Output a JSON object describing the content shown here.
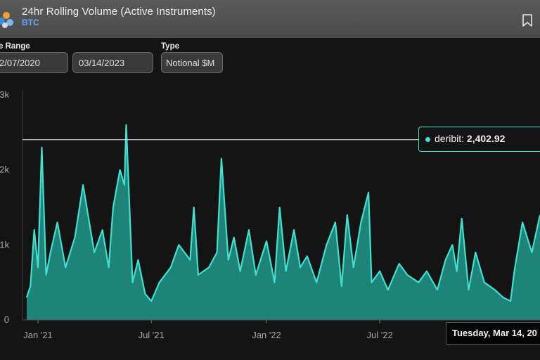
{
  "header": {
    "title": "24hr Rolling Volume (Active Instruments)",
    "subtitle": "BTC",
    "bookmark_icon": "bookmark-icon",
    "logo_icon": "deribit-logo-icon"
  },
  "filters": {
    "date_range_label": "e Range",
    "start_date": "2/07/2020",
    "end_date": "03/14/2023",
    "type_label": "Type",
    "type_value": "Notional $M"
  },
  "colors": {
    "series": "#3fe0cf",
    "fill": "#22a99c",
    "background": "#141414"
  },
  "tooltip": {
    "series": "deribit",
    "value": "2,402.92"
  },
  "crosshair_date": "Tuesday, Mar 14, 20",
  "chart_data": {
    "type": "area",
    "title": "24hr Rolling Volume (Active Instruments)",
    "ylim": [
      0,
      3000
    ],
    "ytick_labels": [
      "0",
      "1k",
      "2k",
      "3k"
    ],
    "yticks": [
      0,
      1000,
      2000,
      3000
    ],
    "xlim": [
      "2020-12-14",
      "2023-03-14"
    ],
    "xtick_labels": [
      "Jan '21",
      "Jul '21",
      "Jan '22",
      "Jul '22"
    ],
    "xticks": [
      "2021-01-01",
      "2021-07-01",
      "2022-01-01",
      "2022-07-01"
    ],
    "reference_line": 2402.92,
    "grid": false,
    "series": [
      {
        "name": "deribit",
        "x": [
          "2020-12-14",
          "2020-12-20",
          "2020-12-26",
          "2021-01-01",
          "2021-01-07",
          "2021-01-14",
          "2021-01-21",
          "2021-02-01",
          "2021-02-14",
          "2021-03-01",
          "2021-03-14",
          "2021-04-01",
          "2021-04-14",
          "2021-04-24",
          "2021-05-01",
          "2021-05-12",
          "2021-05-19",
          "2021-05-22",
          "2021-06-01",
          "2021-06-10",
          "2021-06-21",
          "2021-07-01",
          "2021-07-14",
          "2021-08-01",
          "2021-08-14",
          "2021-09-01",
          "2021-09-07",
          "2021-09-14",
          "2021-10-01",
          "2021-10-14",
          "2021-10-21",
          "2021-11-01",
          "2021-11-10",
          "2021-11-20",
          "2021-12-04",
          "2021-12-15",
          "2022-01-01",
          "2022-01-14",
          "2022-01-22",
          "2022-02-01",
          "2022-02-14",
          "2022-02-24",
          "2022-03-07",
          "2022-03-22",
          "2022-04-07",
          "2022-04-21",
          "2022-05-01",
          "2022-05-10",
          "2022-05-20",
          "2022-06-01",
          "2022-06-13",
          "2022-06-18",
          "2022-07-01",
          "2022-07-14",
          "2022-08-01",
          "2022-08-14",
          "2022-09-01",
          "2022-09-14",
          "2022-10-01",
          "2022-10-14",
          "2022-10-25",
          "2022-11-01",
          "2022-11-09",
          "2022-11-20",
          "2022-12-01",
          "2022-12-15",
          "2023-01-01",
          "2023-01-14",
          "2023-01-26",
          "2023-02-01",
          "2023-02-14",
          "2023-03-01",
          "2023-03-14"
        ],
        "values": [
          300,
          450,
          1200,
          700,
          2300,
          600,
          900,
          1300,
          700,
          1100,
          1800,
          900,
          1200,
          700,
          1500,
          2000,
          1800,
          2600,
          500,
          800,
          350,
          250,
          500,
          700,
          1000,
          800,
          1500,
          600,
          700,
          900,
          2150,
          800,
          1100,
          650,
          1200,
          600,
          1050,
          500,
          1500,
          650,
          1200,
          700,
          850,
          500,
          1000,
          1300,
          450,
          1400,
          700,
          1300,
          1700,
          500,
          650,
          400,
          750,
          600,
          500,
          650,
          400,
          800,
          1000,
          650,
          1350,
          400,
          900,
          500,
          400,
          300,
          250,
          650,
          1300,
          900,
          1400
        ]
      }
    ]
  }
}
